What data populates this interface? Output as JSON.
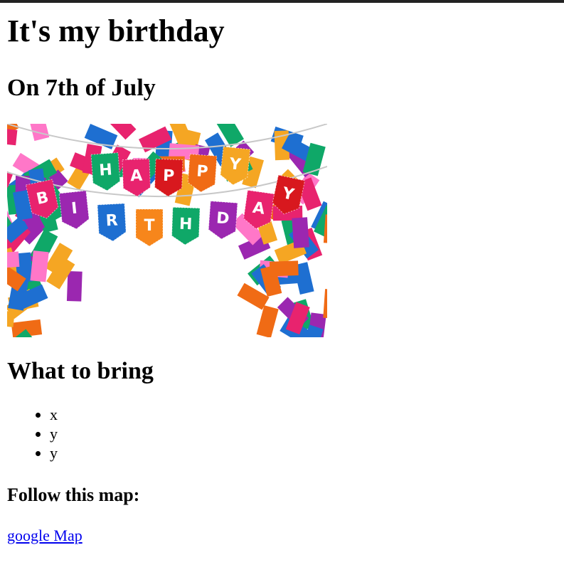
{
  "page": {
    "title": "It's my birthday",
    "date": "On 7th of July",
    "bring_heading": "What to bring",
    "bring_items": [
      "x",
      "y",
      "y"
    ],
    "map_heading": "Follow this map:",
    "map_link": "google Map"
  },
  "banner": {
    "row1_letters": [
      "H",
      "A",
      "P",
      "P",
      "Y"
    ],
    "row2_letters": [
      "B",
      "I",
      "R",
      "T",
      "H",
      "D",
      "A",
      "Y"
    ],
    "row1_colors": [
      "#0fa868",
      "#e8236e",
      "#d8181e",
      "#f06b15",
      "#f5a623"
    ],
    "row2_colors": [
      "#e8236e",
      "#9b27b0",
      "#1e6fd1",
      "#f7861b",
      "#0fa868",
      "#9b27b0",
      "#e8236e",
      "#d8181e"
    ],
    "confetti_colors": [
      "#e8236e",
      "#1e6fd1",
      "#0fa868",
      "#f5a623",
      "#9b27b0",
      "#f06b15",
      "#ff77c8"
    ]
  },
  "colors": {
    "link": "#0000ee",
    "top_rule": "#222222"
  }
}
